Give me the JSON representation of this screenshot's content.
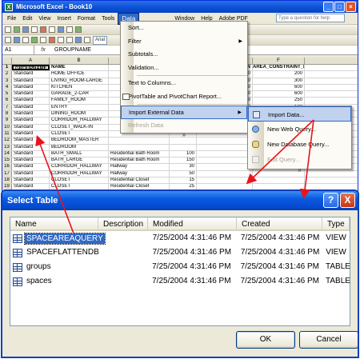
{
  "excel": {
    "title": "Microsoft Excel - Book10",
    "menus": [
      "File",
      "Edit",
      "View",
      "Insert",
      "Format",
      "Tools",
      "Data",
      "Window",
      "Help",
      "Adobe PDF"
    ],
    "question_placeholder": "Type a question for help",
    "font_name": "Arial",
    "name_box": "A1",
    "fx": "fx",
    "formula_value": "GROUPNAME",
    "columns": [
      "A",
      "B",
      "C",
      "D",
      "E",
      "F"
    ],
    "rows": [
      {
        "n": "1",
        "a": "GROUPNAME",
        "b": "NAME",
        "c": "",
        "e": "CONSTRAINT_MIN",
        "f": "AREA_CONSTRAINT_MAX"
      },
      {
        "n": "2",
        "a": "Standard",
        "b": "HOME OFFICE",
        "c": "",
        "e": "100",
        "f": "200"
      },
      {
        "n": "3",
        "a": "Standard",
        "b": "LIVING_ROOM-LARGE",
        "c": "",
        "e": "100",
        "f": "300"
      },
      {
        "n": "4",
        "a": "Standard",
        "b": "KITCHEN",
        "c": "",
        "e": "400",
        "f": "600"
      },
      {
        "n": "5",
        "a": "Standard",
        "b": "GARAGE_2-CAR",
        "c": "",
        "e": "200",
        "f": "600"
      },
      {
        "n": "6",
        "a": "Standard",
        "b": "FAMILY_ROOM",
        "c": "",
        "e": "150",
        "f": "250"
      },
      {
        "n": "7",
        "a": "Standard",
        "b": "ENTRY",
        "c": "",
        "e": "50",
        "f": "100"
      },
      {
        "n": "8",
        "a": "Standard",
        "b": "DINING_ROOM",
        "c": "",
        "e": "",
        "f": ""
      },
      {
        "n": "9",
        "a": "Standard",
        "b": "CORRIDOR_HALLWAY",
        "c": "",
        "e": "",
        "f": ""
      },
      {
        "n": "10",
        "a": "Standard",
        "b": "CLOSET_WALK-IN",
        "c": "",
        "e": "",
        "f": ""
      },
      {
        "n": "11",
        "a": "Standard",
        "b": "CLOSET",
        "c": "",
        "e": "",
        "f": ""
      },
      {
        "n": "12",
        "a": "Standard",
        "b": "BEDROOM_MASTER",
        "c": "",
        "e": "",
        "f": ""
      },
      {
        "n": "13",
        "a": "Standard",
        "b": "BEDROOM",
        "c": "",
        "e": "",
        "f": ""
      },
      {
        "n": "14",
        "a": "Standard",
        "b": "BATH_SMALL",
        "c": "Residential Bath Room",
        "d": "100",
        "e": "",
        "f": ""
      },
      {
        "n": "15",
        "a": "Standard",
        "b": "BATH_LARGE",
        "c": "Residential Bath Room",
        "d": "150",
        "e": "",
        "f": ""
      },
      {
        "n": "16",
        "a": "Standard",
        "b": "CORRIDOR_HALLWAY",
        "c": "Hallway",
        "d": "30",
        "e": "",
        "f": ""
      },
      {
        "n": "17",
        "a": "Standard",
        "b": "CORRIDOR_HALLWAY",
        "c": "Hallway",
        "d": "50",
        "e": "",
        "f": ""
      },
      {
        "n": "18",
        "a": "Standard",
        "b": "CLOSET",
        "c": "Residential Closet",
        "d": "15",
        "e": "",
        "f": ""
      },
      {
        "n": "19",
        "a": "Standard",
        "b": "CLOSET",
        "c": "Residential Closet",
        "d": "25",
        "e": "",
        "f": ""
      }
    ]
  },
  "data_menu": {
    "sort": "Sort...",
    "filter": "Filter",
    "subtotals": "Subtotals...",
    "validation": "Validation...",
    "text_to_columns": "Text to Columns...",
    "pivot": "PivotTable and PivotChart Report...",
    "import_external": "Import External Data",
    "refresh": "Refresh Data",
    "more": "»"
  },
  "import_submenu": {
    "import_data": "Import Data...",
    "new_web_query": "New Web Query...",
    "new_db_query": "New Database Query...",
    "edit_query": "Edit Query...",
    "more": "»"
  },
  "dialog": {
    "title": "Select Table",
    "help_glyph": "?",
    "close_glyph": "X",
    "columns": {
      "name": "Name",
      "description": "Description",
      "modified": "Modified",
      "created": "Created",
      "type": "Type"
    },
    "rows": [
      {
        "name": "SPACEAREAQUERY",
        "description": "",
        "modified": "7/25/2004 4:31:46 PM",
        "created": "7/25/2004 4:31:46 PM",
        "type": "VIEW"
      },
      {
        "name": "SPACEFLATTENDB",
        "description": "",
        "modified": "7/25/2004 4:31:46 PM",
        "created": "7/25/2004 4:31:46 PM",
        "type": "VIEW"
      },
      {
        "name": "groups",
        "description": "",
        "modified": "7/25/2004 4:31:46 PM",
        "created": "7/25/2004 4:31:46 PM",
        "type": "TABLE"
      },
      {
        "name": "spaces",
        "description": "",
        "modified": "7/25/2004 4:31:46 PM",
        "created": "7/25/2004 4:31:46 PM",
        "type": "TABLE"
      }
    ],
    "ok": "OK",
    "cancel": "Cancel"
  },
  "colors": {
    "selection": "#316ac5",
    "arrow": "#e8141c",
    "title_blue": "#0a5ae0"
  }
}
